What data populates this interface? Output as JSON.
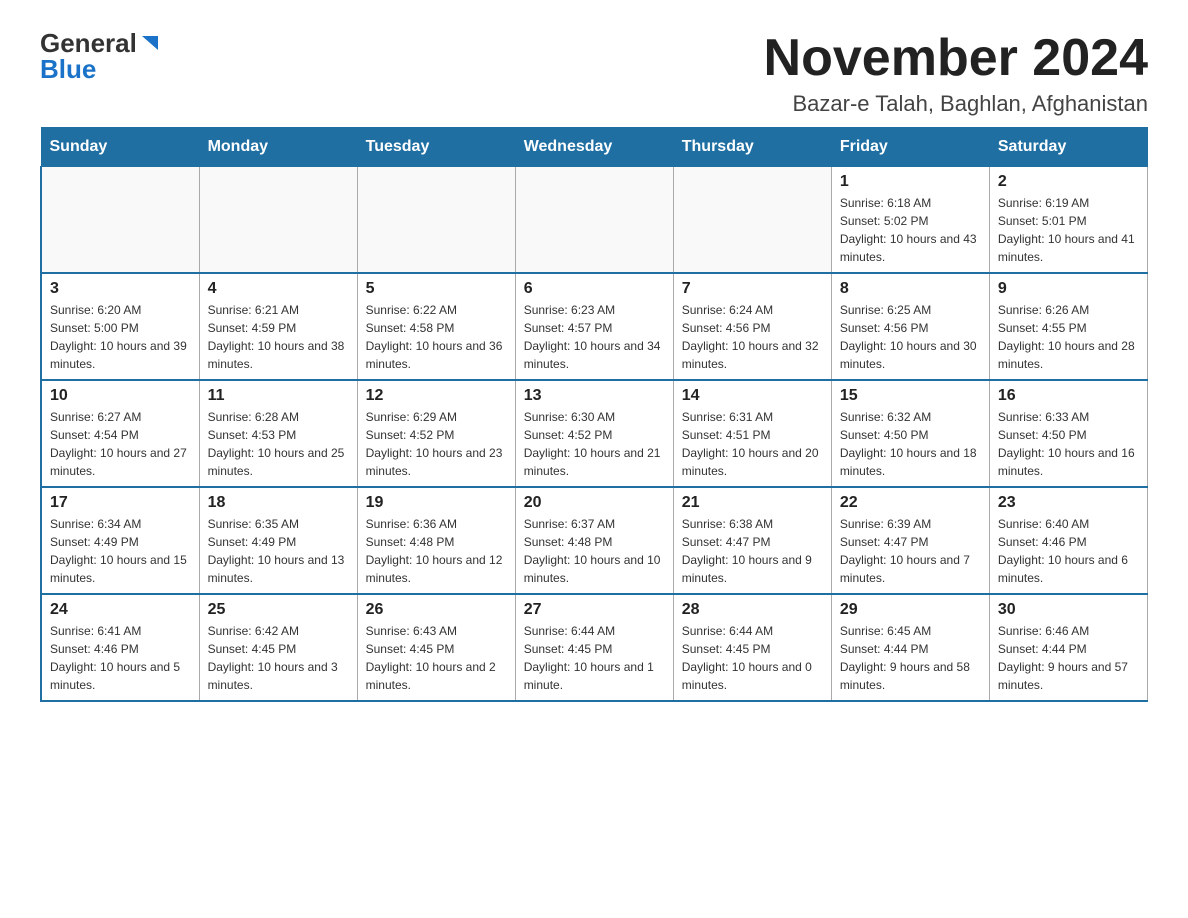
{
  "header": {
    "logo_general": "General",
    "logo_blue": "Blue",
    "month_title": "November 2024",
    "location": "Bazar-e Talah, Baghlan, Afghanistan"
  },
  "days_of_week": [
    "Sunday",
    "Monday",
    "Tuesday",
    "Wednesday",
    "Thursday",
    "Friday",
    "Saturday"
  ],
  "weeks": [
    [
      {
        "day": "",
        "info": ""
      },
      {
        "day": "",
        "info": ""
      },
      {
        "day": "",
        "info": ""
      },
      {
        "day": "",
        "info": ""
      },
      {
        "day": "",
        "info": ""
      },
      {
        "day": "1",
        "info": "Sunrise: 6:18 AM\nSunset: 5:02 PM\nDaylight: 10 hours and 43 minutes."
      },
      {
        "day": "2",
        "info": "Sunrise: 6:19 AM\nSunset: 5:01 PM\nDaylight: 10 hours and 41 minutes."
      }
    ],
    [
      {
        "day": "3",
        "info": "Sunrise: 6:20 AM\nSunset: 5:00 PM\nDaylight: 10 hours and 39 minutes."
      },
      {
        "day": "4",
        "info": "Sunrise: 6:21 AM\nSunset: 4:59 PM\nDaylight: 10 hours and 38 minutes."
      },
      {
        "day": "5",
        "info": "Sunrise: 6:22 AM\nSunset: 4:58 PM\nDaylight: 10 hours and 36 minutes."
      },
      {
        "day": "6",
        "info": "Sunrise: 6:23 AM\nSunset: 4:57 PM\nDaylight: 10 hours and 34 minutes."
      },
      {
        "day": "7",
        "info": "Sunrise: 6:24 AM\nSunset: 4:56 PM\nDaylight: 10 hours and 32 minutes."
      },
      {
        "day": "8",
        "info": "Sunrise: 6:25 AM\nSunset: 4:56 PM\nDaylight: 10 hours and 30 minutes."
      },
      {
        "day": "9",
        "info": "Sunrise: 6:26 AM\nSunset: 4:55 PM\nDaylight: 10 hours and 28 minutes."
      }
    ],
    [
      {
        "day": "10",
        "info": "Sunrise: 6:27 AM\nSunset: 4:54 PM\nDaylight: 10 hours and 27 minutes."
      },
      {
        "day": "11",
        "info": "Sunrise: 6:28 AM\nSunset: 4:53 PM\nDaylight: 10 hours and 25 minutes."
      },
      {
        "day": "12",
        "info": "Sunrise: 6:29 AM\nSunset: 4:52 PM\nDaylight: 10 hours and 23 minutes."
      },
      {
        "day": "13",
        "info": "Sunrise: 6:30 AM\nSunset: 4:52 PM\nDaylight: 10 hours and 21 minutes."
      },
      {
        "day": "14",
        "info": "Sunrise: 6:31 AM\nSunset: 4:51 PM\nDaylight: 10 hours and 20 minutes."
      },
      {
        "day": "15",
        "info": "Sunrise: 6:32 AM\nSunset: 4:50 PM\nDaylight: 10 hours and 18 minutes."
      },
      {
        "day": "16",
        "info": "Sunrise: 6:33 AM\nSunset: 4:50 PM\nDaylight: 10 hours and 16 minutes."
      }
    ],
    [
      {
        "day": "17",
        "info": "Sunrise: 6:34 AM\nSunset: 4:49 PM\nDaylight: 10 hours and 15 minutes."
      },
      {
        "day": "18",
        "info": "Sunrise: 6:35 AM\nSunset: 4:49 PM\nDaylight: 10 hours and 13 minutes."
      },
      {
        "day": "19",
        "info": "Sunrise: 6:36 AM\nSunset: 4:48 PM\nDaylight: 10 hours and 12 minutes."
      },
      {
        "day": "20",
        "info": "Sunrise: 6:37 AM\nSunset: 4:48 PM\nDaylight: 10 hours and 10 minutes."
      },
      {
        "day": "21",
        "info": "Sunrise: 6:38 AM\nSunset: 4:47 PM\nDaylight: 10 hours and 9 minutes."
      },
      {
        "day": "22",
        "info": "Sunrise: 6:39 AM\nSunset: 4:47 PM\nDaylight: 10 hours and 7 minutes."
      },
      {
        "day": "23",
        "info": "Sunrise: 6:40 AM\nSunset: 4:46 PM\nDaylight: 10 hours and 6 minutes."
      }
    ],
    [
      {
        "day": "24",
        "info": "Sunrise: 6:41 AM\nSunset: 4:46 PM\nDaylight: 10 hours and 5 minutes."
      },
      {
        "day": "25",
        "info": "Sunrise: 6:42 AM\nSunset: 4:45 PM\nDaylight: 10 hours and 3 minutes."
      },
      {
        "day": "26",
        "info": "Sunrise: 6:43 AM\nSunset: 4:45 PM\nDaylight: 10 hours and 2 minutes."
      },
      {
        "day": "27",
        "info": "Sunrise: 6:44 AM\nSunset: 4:45 PM\nDaylight: 10 hours and 1 minute."
      },
      {
        "day": "28",
        "info": "Sunrise: 6:44 AM\nSunset: 4:45 PM\nDaylight: 10 hours and 0 minutes."
      },
      {
        "day": "29",
        "info": "Sunrise: 6:45 AM\nSunset: 4:44 PM\nDaylight: 9 hours and 58 minutes."
      },
      {
        "day": "30",
        "info": "Sunrise: 6:46 AM\nSunset: 4:44 PM\nDaylight: 9 hours and 57 minutes."
      }
    ]
  ]
}
